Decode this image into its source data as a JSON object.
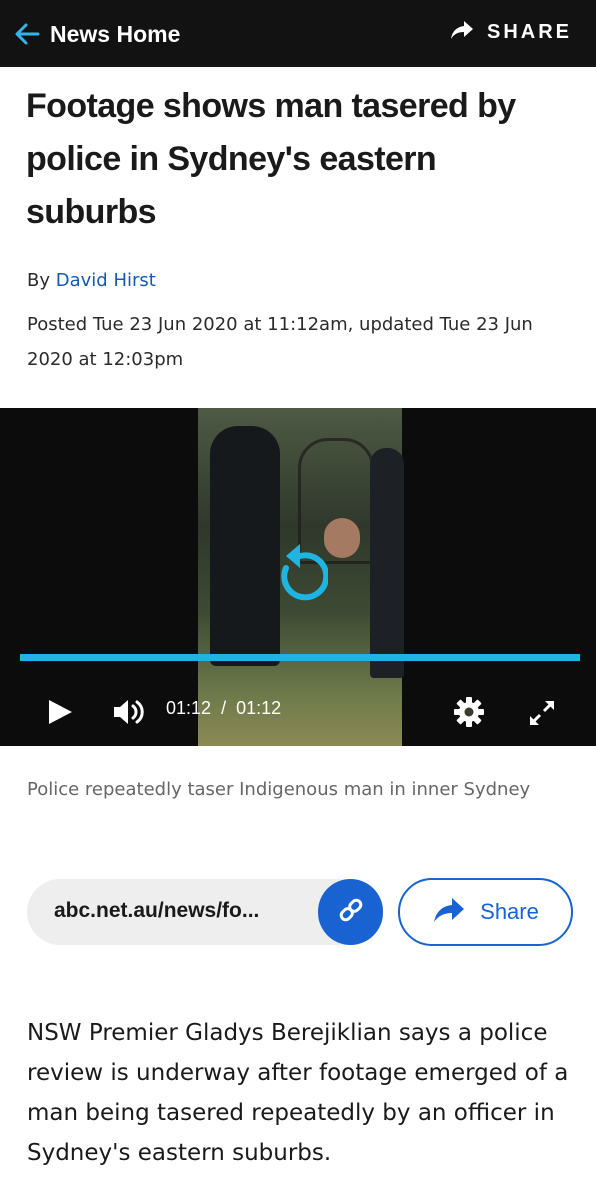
{
  "header": {
    "back_label": "News Home",
    "share_label": "SHARE"
  },
  "article": {
    "headline": "Footage shows man tasered by police in Sydney's eastern suburbs",
    "byline_prefix": "By",
    "author": "David Hirst",
    "posted": "Posted Tue 23 Jun 2020 at 11:12am, updated Tue 23 Jun 2020 at 12:03pm",
    "body": "NSW Premier Gladys Berejiklian says a police review is underway after footage emerged of a man being tasered repeatedly by an officer in Sydney's eastern suburbs."
  },
  "video": {
    "current_time": "01:12",
    "separator": "/",
    "duration": "01:12",
    "progress_percent": 100,
    "caption": "Police repeatedly taser Indigenous man in inner Sydney",
    "icons": {
      "replay": "replay-icon",
      "play": "play-icon",
      "volume": "volume-icon",
      "settings": "gear-icon",
      "fullscreen": "fullscreen-icon"
    }
  },
  "share_bar": {
    "url": "abc.net.au/news/fo...",
    "share_label": "Share"
  },
  "colors": {
    "header_bg": "#121212",
    "accent_blue": "#1962d1",
    "link_blue": "#1559b3",
    "progress": "#1fb5e3"
  }
}
